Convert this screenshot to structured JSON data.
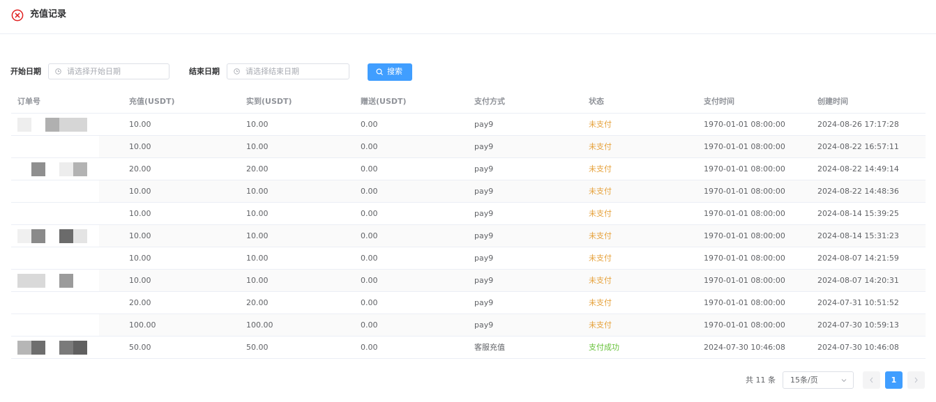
{
  "header": {
    "title": "充值记录",
    "icon": "close-circle-icon",
    "icon_color": "#e02020"
  },
  "filters": {
    "start_label": "开始日期",
    "start_placeholder": "请选择开始日期",
    "end_label": "结束日期",
    "end_placeholder": "请选择结束日期",
    "search_label": "搜索",
    "accent": "#409eff"
  },
  "table": {
    "columns": [
      "订单号",
      "充值(USDT)",
      "实到(USDT)",
      "赠送(USDT)",
      "支付方式",
      "状态",
      "支付时间",
      "创建时间"
    ],
    "rows": [
      {
        "recharge": "10.00",
        "received": "10.00",
        "bonus": "0.00",
        "method": "pay9",
        "status": "未支付",
        "pay_time": "1970-01-01 08:00:00",
        "create_time": "2024-08-26 17:17:28"
      },
      {
        "recharge": "10.00",
        "received": "10.00",
        "bonus": "0.00",
        "method": "pay9",
        "status": "未支付",
        "pay_time": "1970-01-01 08:00:00",
        "create_time": "2024-08-22 16:57:11"
      },
      {
        "recharge": "20.00",
        "received": "20.00",
        "bonus": "0.00",
        "method": "pay9",
        "status": "未支付",
        "pay_time": "1970-01-01 08:00:00",
        "create_time": "2024-08-22 14:49:14"
      },
      {
        "recharge": "10.00",
        "received": "10.00",
        "bonus": "0.00",
        "method": "pay9",
        "status": "未支付",
        "pay_time": "1970-01-01 08:00:00",
        "create_time": "2024-08-22 14:48:36"
      },
      {
        "recharge": "10.00",
        "received": "10.00",
        "bonus": "0.00",
        "method": "pay9",
        "status": "未支付",
        "pay_time": "1970-01-01 08:00:00",
        "create_time": "2024-08-14 15:39:25"
      },
      {
        "recharge": "10.00",
        "received": "10.00",
        "bonus": "0.00",
        "method": "pay9",
        "status": "未支付",
        "pay_time": "1970-01-01 08:00:00",
        "create_time": "2024-08-14 15:31:23"
      },
      {
        "recharge": "10.00",
        "received": "10.00",
        "bonus": "0.00",
        "method": "pay9",
        "status": "未支付",
        "pay_time": "1970-01-01 08:00:00",
        "create_time": "2024-08-07 14:21:59"
      },
      {
        "recharge": "10.00",
        "received": "10.00",
        "bonus": "0.00",
        "method": "pay9",
        "status": "未支付",
        "pay_time": "1970-01-01 08:00:00",
        "create_time": "2024-08-07 14:20:31"
      },
      {
        "recharge": "20.00",
        "received": "20.00",
        "bonus": "0.00",
        "method": "pay9",
        "status": "未支付",
        "pay_time": "1970-01-01 08:00:00",
        "create_time": "2024-07-31 10:51:52"
      },
      {
        "recharge": "100.00",
        "received": "100.00",
        "bonus": "0.00",
        "method": "pay9",
        "status": "未支付",
        "pay_time": "1970-01-01 08:00:00",
        "create_time": "2024-07-30 10:59:13"
      },
      {
        "recharge": "50.00",
        "received": "50.00",
        "bonus": "0.00",
        "method": "客服充值",
        "status": "支付成功",
        "pay_time": "2024-07-30 10:46:08",
        "create_time": "2024-07-30 10:46:08"
      }
    ],
    "status_colors": {
      "unpaid": "#e6a23c",
      "paid": "#67c23a"
    }
  },
  "pagination": {
    "total_text": "共 11 条",
    "page_size": "15条/页",
    "current_page": "1"
  }
}
